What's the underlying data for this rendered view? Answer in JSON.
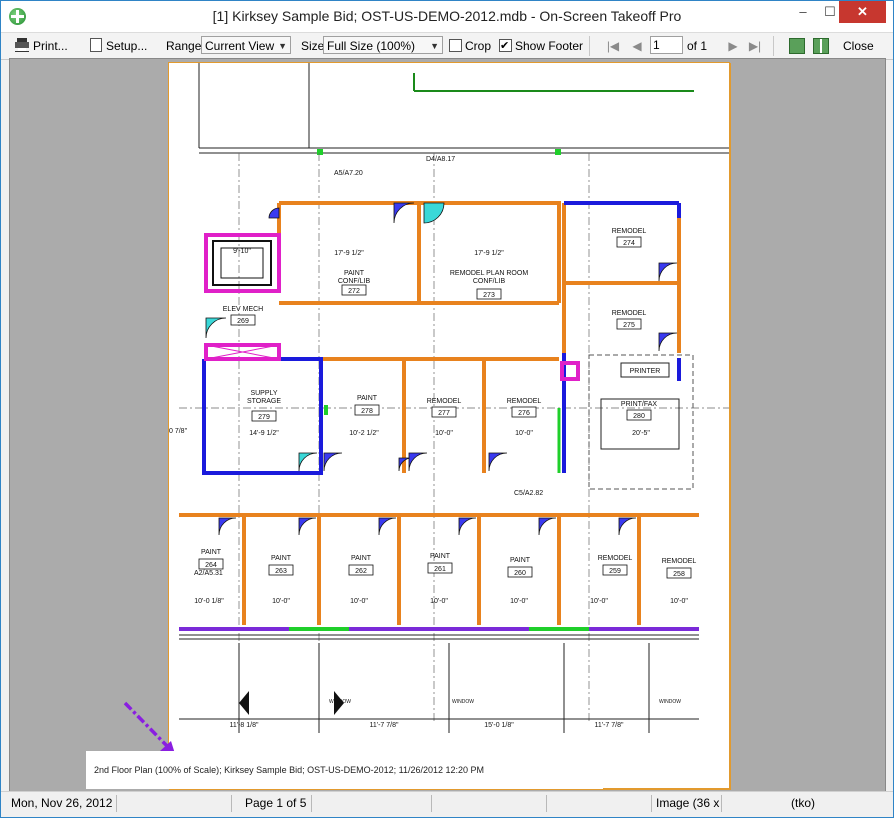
{
  "window": {
    "title": "[1] Kirksey Sample Bid; OST-US-DEMO-2012.mdb - On-Screen Takeoff Pro",
    "app_icon": "takeoff-app-icon",
    "controls": {
      "minimize": "‒",
      "maximize": "☐",
      "close": "✕"
    }
  },
  "toolbar": {
    "print_label": "Print...",
    "setup_label": "Setup...",
    "range_label": "Range",
    "range_value": "Current View",
    "size_label": "Size",
    "size_value": "Full Size (100%)",
    "crop_label": "Crop",
    "crop_checked": false,
    "show_footer_label": "Show Footer",
    "show_footer_checked": true,
    "page_value": "1",
    "page_of": "of 1",
    "close_label": "Close",
    "nav_icons": [
      "first-page-icon",
      "prev-page-icon",
      "next-page-icon",
      "last-page-icon"
    ],
    "view_icons": [
      "single-page-icon",
      "multi-page-icon"
    ]
  },
  "drawing": {
    "labels": {
      "a5": "A5/A7.20",
      "d4": "D4/A8.17",
      "c5": "C5/A2.82",
      "a2": "A2/A5.31"
    },
    "rooms_top": [
      {
        "name": "PAINT\nCONF/LIB",
        "number": "272"
      },
      {
        "name": "REMODEL PLAN ROOM\nCONF/LIB",
        "number": "273"
      },
      {
        "name": "REMODEL",
        "number": "274"
      },
      {
        "name": "REMODEL",
        "number": "275"
      },
      {
        "name": "ELEV MECH",
        "number": "269"
      }
    ],
    "rooms_mid": [
      {
        "name": "SUPPLY\nSTORAGE",
        "number": "279"
      },
      {
        "name": "PAINT",
        "number": "278"
      },
      {
        "name": "REMODEL",
        "number": "277"
      },
      {
        "name": "REMODEL",
        "number": "276"
      },
      {
        "name": "PRINT/FAX",
        "number": "280"
      }
    ],
    "rooms_bottom": [
      {
        "name": "PAINT",
        "number": "264"
      },
      {
        "name": "PAINT",
        "number": "263"
      },
      {
        "name": "PAINT",
        "number": "262"
      },
      {
        "name": "PAINT",
        "number": "261"
      },
      {
        "name": "PAINT",
        "number": "260"
      },
      {
        "name": "REMODEL",
        "number": "259"
      },
      {
        "name": "REMODEL",
        "number": "258"
      }
    ],
    "dims_top": [
      "17'-9 1/2\"",
      "17'-9 1/2\"",
      "9'-10\""
    ],
    "dims_mid": [
      "14'-9 1/2\"",
      "10'-2 1/2\"",
      "10'-0\"",
      "10'-0\"",
      "20'-5\""
    ],
    "dims_bottom": [
      "10'-0 1/8\"",
      "10'-0\"",
      "10'-0\"",
      "10'-0\"",
      "10'-0\"",
      "10'-0\"",
      "10'-0\""
    ],
    "dims_lower": [
      "11'-8 1/8\"",
      "11'-7 7/8\"",
      "15'-0 1/8\"",
      "11'-7 7/8\""
    ],
    "printer_label": "PRINTER",
    "window_label": "WINDOW",
    "left_dim": "0 7/8\""
  },
  "footer_text": "2nd Floor Plan (100% of Scale); Kirksey Sample Bid; OST-US-DEMO-2012; 11/26/2012 12:20 PM",
  "status": {
    "date": "Mon, Nov 26, 2012",
    "page": "Page 1 of 5",
    "image": "Image (36 x",
    "user": "(tko)"
  },
  "colors": {
    "orange_wall": "#e8821e",
    "blue_wall": "#1a1adc",
    "magenta": "#e020c8",
    "purple": "#7a2ad8",
    "green": "#1fcf2a",
    "door_blue": "#3a3af0",
    "door_cyan": "#3ad8d8",
    "arrow_purple": "#8a1ee0"
  }
}
